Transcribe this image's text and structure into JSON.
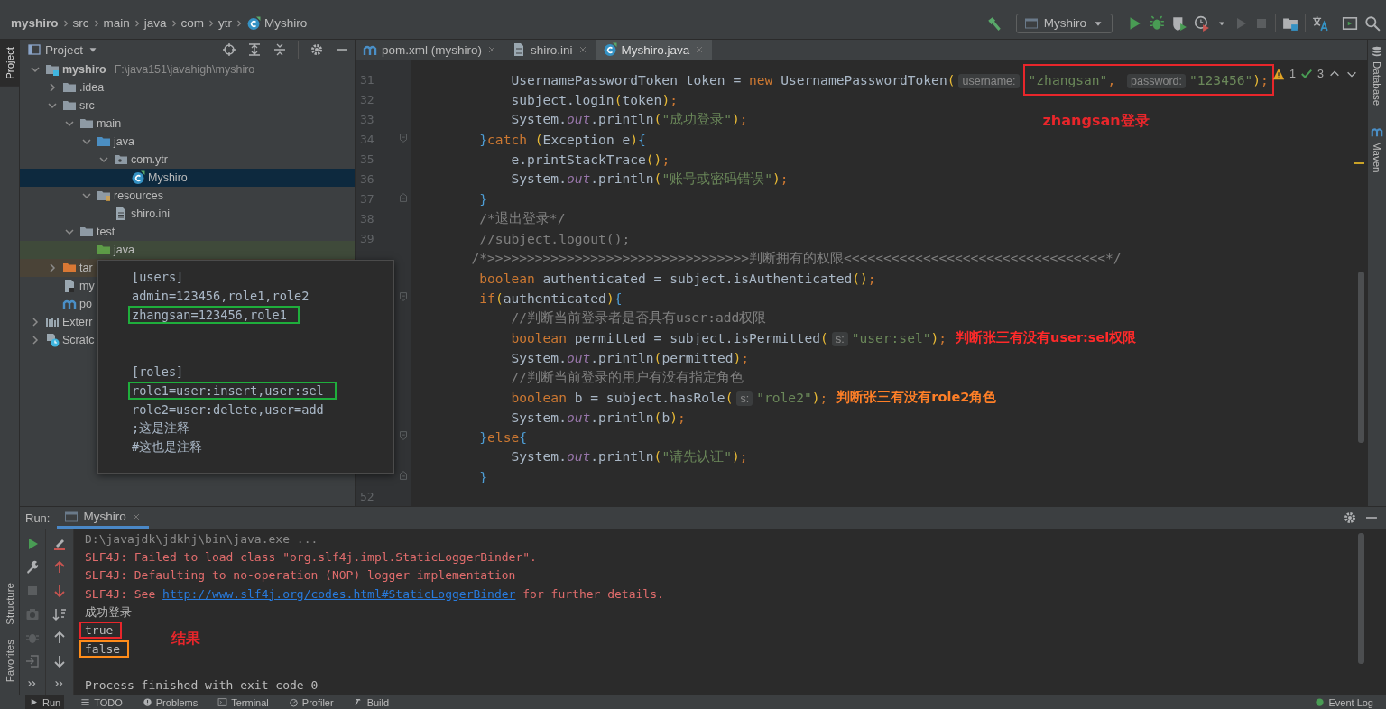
{
  "breadcrumbs": [
    {
      "label": "myshiro",
      "kind": "project"
    },
    {
      "label": "src",
      "kind": "dir"
    },
    {
      "label": "main",
      "kind": "dir"
    },
    {
      "label": "java",
      "kind": "dir"
    },
    {
      "label": "com",
      "kind": "dir"
    },
    {
      "label": "ytr",
      "kind": "dir"
    },
    {
      "label": "Myshiro",
      "kind": "class"
    }
  ],
  "toolbar": {
    "run_config": "Myshiro"
  },
  "left_tools": [
    {
      "label": "Project",
      "selected": true
    },
    {
      "label": "Structure",
      "selected": false
    },
    {
      "label": "Favorites",
      "selected": false
    }
  ],
  "project_panel": {
    "title": "Project",
    "tree": [
      {
        "label": "myshiro",
        "path": "F:\\java151\\javahigh\\myshiro",
        "kind": "module",
        "expanded": true,
        "selected": false,
        "children": [
          {
            "label": ".idea",
            "kind": "folder",
            "expanded": false,
            "selected": false
          },
          {
            "label": "src",
            "kind": "folder",
            "expanded": true,
            "selected": false,
            "children": [
              {
                "label": "main",
                "kind": "folder",
                "expanded": true,
                "selected": false,
                "children": [
                  {
                    "label": "java",
                    "kind": "source",
                    "expanded": true,
                    "selected": false,
                    "children": [
                      {
                        "label": "com.ytr",
                        "kind": "package",
                        "expanded": true,
                        "selected": false,
                        "children": [
                          {
                            "label": "Myshiro",
                            "kind": "class",
                            "selected": true
                          }
                        ]
                      }
                    ]
                  },
                  {
                    "label": "resources",
                    "kind": "resources",
                    "expanded": true,
                    "selected": false,
                    "children": [
                      {
                        "label": "shiro.ini",
                        "kind": "file",
                        "selected": false
                      }
                    ]
                  }
                ]
              },
              {
                "label": "test",
                "kind": "folder",
                "expanded": true,
                "selected": false,
                "children": [
                  {
                    "label": "java",
                    "kind": "test",
                    "selected": false
                  }
                ]
              }
            ]
          },
          {
            "label": "tar",
            "kind": "excluded",
            "expanded": false,
            "selected": false
          },
          {
            "label": "my",
            "kind": "iml",
            "selected": false
          },
          {
            "label": "po",
            "kind": "arches",
            "selected": false
          }
        ]
      },
      {
        "label": "Exterr",
        "kind": "libraries",
        "expanded": false,
        "selected": false
      },
      {
        "label": "Scratc",
        "kind": "scratches",
        "expanded": false,
        "selected": false
      }
    ]
  },
  "editor_tabs": [
    {
      "label": "pom.xml (myshiro)",
      "kind": "arches",
      "selected": false
    },
    {
      "label": "shiro.ini",
      "kind": "file",
      "selected": false
    },
    {
      "label": "Myshiro.java",
      "kind": "class",
      "selected": true
    }
  ],
  "editor": {
    "inspections": {
      "warnings": "1",
      "checks": "3"
    },
    "lines": [
      {
        "n": "31",
        "tokens": [
          {
            "t": "            UsernamePasswordToken token = ",
            "kind": "p"
          },
          {
            "t": "new",
            "kind": "kw"
          },
          {
            "t": " UsernamePasswordToken",
            "kind": "p"
          },
          {
            "t": "(",
            "kind": "brk"
          },
          {
            "t": "username:",
            "kind": "hint"
          }
        ],
        "box": {
          "color": "#e8262b",
          "tokens": [
            {
              "t": "\"zhangsan\"",
              "kind": "str"
            },
            {
              "t": ", ",
              "kind": "kw"
            },
            {
              "t": "password:",
              "kind": "hint"
            },
            {
              "t": "\"123456\"",
              "kind": "str"
            },
            {
              "t": ")",
              "kind": "brk"
            },
            {
              "t": ";",
              "kind": "kw"
            }
          ],
          "note": "zhangsan登录"
        }
      },
      {
        "n": "32",
        "tokens": [
          {
            "t": "            subject.login",
            "kind": "p"
          },
          {
            "t": "(",
            "kind": "brk"
          },
          {
            "t": "token",
            "kind": "p"
          },
          {
            "t": ")",
            "kind": "brk"
          },
          {
            "t": ";",
            "kind": "kw"
          }
        ]
      },
      {
        "n": "33",
        "tokens": [
          {
            "t": "            System.",
            "kind": "p"
          },
          {
            "t": "out",
            "kind": "fld"
          },
          {
            "t": ".println",
            "kind": "p"
          },
          {
            "t": "(",
            "kind": "brk"
          },
          {
            "t": "\"成功登录\"",
            "kind": "str"
          },
          {
            "t": ")",
            "kind": "brk"
          },
          {
            "t": ";",
            "kind": "kw"
          }
        ]
      },
      {
        "n": "34",
        "fold": {
          "kind": "start"
        },
        "tokens": [
          {
            "t": "        }",
            "kind": "brc"
          },
          {
            "t": "catch",
            "kind": "kw"
          },
          {
            "t": " (",
            "kind": "brk"
          },
          {
            "t": "Exception e",
            "kind": "p"
          },
          {
            "t": ")",
            "kind": "brk"
          },
          {
            "t": "{",
            "kind": "brc"
          }
        ]
      },
      {
        "n": "35",
        "tokens": [
          {
            "t": "            e.printStackTrace",
            "kind": "p"
          },
          {
            "t": "()",
            "kind": "brk"
          },
          {
            "t": ";",
            "kind": "kw"
          }
        ]
      },
      {
        "n": "36",
        "tokens": [
          {
            "t": "            System.",
            "kind": "p"
          },
          {
            "t": "out",
            "kind": "fld"
          },
          {
            "t": ".println",
            "kind": "p"
          },
          {
            "t": "(",
            "kind": "brk"
          },
          {
            "t": "\"账号或密码错误\"",
            "kind": "str"
          },
          {
            "t": ")",
            "kind": "brk"
          },
          {
            "t": ";",
            "kind": "kw"
          }
        ]
      },
      {
        "n": "37",
        "fold": {
          "kind": "end"
        },
        "tokens": [
          {
            "t": "        }",
            "kind": "brc"
          }
        ]
      },
      {
        "n": "38",
        "tokens": [
          {
            "t": "        /*退出登录*/",
            "kind": "cmt"
          }
        ]
      },
      {
        "n": "39",
        "tokens": [
          {
            "t": "        //subject.logout();",
            "kind": "cmt"
          }
        ]
      },
      {
        "tokens": [
          {
            "t": "       /*>>>>>>>>>>>>>>>>>>>>>>>>>>>>>>>>>判断拥有的权限<<<<<<<<<<<<<<<<<<<<<<<<<<<<<<<<<*/",
            "kind": "cmt"
          }
        ]
      },
      {
        "tokens": [
          {
            "t": "        boolean",
            "kind": "kw"
          },
          {
            "t": " authenticated = subject.isAuthenticated",
            "kind": "p"
          },
          {
            "t": "()",
            "kind": "brk"
          },
          {
            "t": ";",
            "kind": "kw"
          }
        ]
      },
      {
        "fold": {
          "kind": "start"
        },
        "tokens": [
          {
            "t": "        if",
            "kind": "kw"
          },
          {
            "t": "(",
            "kind": "brk"
          },
          {
            "t": "authenticated",
            "kind": "p"
          },
          {
            "t": ")",
            "kind": "brk"
          },
          {
            "t": "{",
            "kind": "brc"
          }
        ]
      },
      {
        "tokens": [
          {
            "t": "            //判断当前登录者是否具有user:add权限",
            "kind": "cmt"
          }
        ]
      },
      {
        "tokens": [
          {
            "t": "            boolean",
            "kind": "kw"
          },
          {
            "t": " permitted = subject.isPermitted",
            "kind": "p"
          },
          {
            "t": "(",
            "kind": "brk"
          },
          {
            "t": "s:",
            "kind": "hint"
          },
          {
            "t": "\"user:sel\"",
            "kind": "str"
          },
          {
            "t": ")",
            "kind": "brk"
          },
          {
            "t": ";",
            "kind": "kw"
          }
        ],
        "note": {
          "text": "判断张三有没有user:sel权限",
          "color": "#ff2a2a"
        }
      },
      {
        "tokens": [
          {
            "t": "            System.",
            "kind": "p"
          },
          {
            "t": "out",
            "kind": "fld"
          },
          {
            "t": ".println",
            "kind": "p"
          },
          {
            "t": "(",
            "kind": "brk"
          },
          {
            "t": "permitted",
            "kind": "p"
          },
          {
            "t": ")",
            "kind": "brk"
          },
          {
            "t": ";",
            "kind": "kw"
          }
        ]
      },
      {
        "tokens": [
          {
            "t": "            //判断当前登录的用户有没有指定角色",
            "kind": "cmt"
          }
        ]
      },
      {
        "tokens": [
          {
            "t": "            boolean",
            "kind": "kw"
          },
          {
            "t": " b = subject.hasRole",
            "kind": "p"
          },
          {
            "t": "(",
            "kind": "brk"
          },
          {
            "t": "s:",
            "kind": "hint"
          },
          {
            "t": "\"role2\"",
            "kind": "str"
          },
          {
            "t": ")",
            "kind": "brk"
          },
          {
            "t": ";",
            "kind": "kw"
          }
        ],
        "note": {
          "text": "判断张三有没有role2角色",
          "color": "#ff7f27"
        }
      },
      {
        "tokens": [
          {
            "t": "            System.",
            "kind": "p"
          },
          {
            "t": "out",
            "kind": "fld"
          },
          {
            "t": ".println",
            "kind": "p"
          },
          {
            "t": "(",
            "kind": "brk"
          },
          {
            "t": "b",
            "kind": "p"
          },
          {
            "t": ")",
            "kind": "brk"
          },
          {
            "t": ";",
            "kind": "kw"
          }
        ]
      },
      {
        "fold": {
          "kind": "start"
        },
        "tokens": [
          {
            "t": "        }",
            "kind": "brc"
          },
          {
            "t": "else",
            "kind": "kw"
          },
          {
            "t": "{",
            "kind": "brc"
          }
        ]
      },
      {
        "tokens": [
          {
            "t": "            System.",
            "kind": "p"
          },
          {
            "t": "out",
            "kind": "fld"
          },
          {
            "t": ".println",
            "kind": "p"
          },
          {
            "t": "(",
            "kind": "brk"
          },
          {
            "t": "\"请先认证\"",
            "kind": "str"
          },
          {
            "t": ")",
            "kind": "brk"
          },
          {
            "t": ";",
            "kind": "kw"
          }
        ]
      },
      {
        "fold": {
          "kind": "end"
        },
        "tokens": [
          {
            "t": "        }",
            "kind": "brc"
          }
        ]
      },
      {
        "n": "52"
      }
    ]
  },
  "popup": {
    "lines": [
      {
        "kind": "text",
        "text": "[users]"
      },
      {
        "kind": "text",
        "text": "admin=123456,role1,role2"
      },
      {
        "kind": "text",
        "text": "zhangsan=123456,role1",
        "color": "#1fae3c"
      },
      {
        "kind": "blank"
      },
      {
        "kind": "blank"
      },
      {
        "kind": "text",
        "text": "[roles]"
      },
      {
        "kind": "text",
        "text": "role1=user:insert,user:sel",
        "color": "#1fae3c"
      },
      {
        "kind": "text",
        "text": "role2=user:delete,user=add"
      },
      {
        "kind": "text",
        "text": ";这是注释"
      },
      {
        "kind": "text",
        "text": "#这也是注释"
      }
    ]
  },
  "right_tools": [
    {
      "label": "Database",
      "kind": "database"
    },
    {
      "label": "Maven",
      "kind": "arches"
    }
  ],
  "run_panel": {
    "label": "Run:",
    "tab": {
      "label": "Myshiro",
      "selected": true
    },
    "console": [
      {
        "kind": "text",
        "tokens": [
          {
            "t": "D:\\javajdk\\jdkhj\\bin\\java.exe ...",
            "kind": "cmd"
          }
        ]
      },
      {
        "kind": "text",
        "tokens": [
          {
            "t": "SLF4J: Failed to load class \"org.slf4j.impl.StaticLoggerBinder\".",
            "kind": "err"
          }
        ]
      },
      {
        "kind": "text",
        "tokens": [
          {
            "t": "SLF4J: Defaulting to no-operation (NOP) logger implementation",
            "kind": "err"
          }
        ]
      },
      {
        "kind": "text",
        "tokens": [
          {
            "t": "SLF4J: See ",
            "kind": "err"
          },
          {
            "t": "http://www.slf4j.org/codes.html#StaticLoggerBinder",
            "kind": "link"
          },
          {
            "t": " for further details.",
            "kind": "err"
          }
        ]
      },
      {
        "kind": "text",
        "tokens": [
          {
            "t": "成功登录",
            "kind": "out"
          }
        ]
      },
      {
        "kind": "text",
        "tokens": [
          {
            "t": "true",
            "kind": "out"
          }
        ],
        "color": "#e8262b",
        "note": {
          "text": "结果",
          "color": "#e8262b"
        }
      },
      {
        "kind": "text",
        "tokens": [
          {
            "t": "false",
            "kind": "out"
          }
        ],
        "color": "#ff8c1a"
      },
      {
        "kind": "blank"
      },
      {
        "kind": "text",
        "tokens": [
          {
            "t": "Process finished with exit code 0",
            "kind": "out"
          }
        ]
      }
    ]
  },
  "bottom_tabs": [
    {
      "label": "Run",
      "kind": "run",
      "selected": true
    },
    {
      "label": "TODO",
      "kind": "list",
      "selected": false
    },
    {
      "label": "Problems",
      "kind": "problems",
      "selected": false
    },
    {
      "label": "Terminal",
      "kind": "terminal",
      "selected": false
    },
    {
      "label": "Profiler",
      "kind": "profiler",
      "selected": false
    },
    {
      "label": "Build",
      "kind": "hammer",
      "selected": false
    }
  ],
  "event_log": {
    "label": "Event Log"
  }
}
